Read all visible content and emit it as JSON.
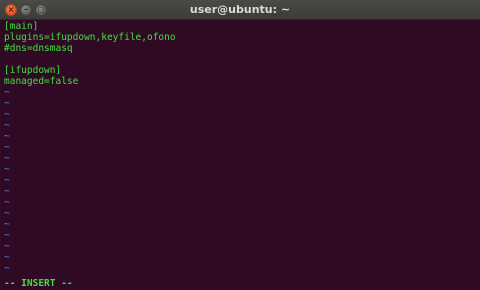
{
  "window": {
    "title": "user@ubuntu: ~",
    "close_glyph": "×",
    "minimize_glyph": "–",
    "maximize_glyph": "□"
  },
  "editor": {
    "lines": [
      "[main]",
      "plugins=ifupdown,keyfile,ofono",
      "#dns=dnsmasq",
      "",
      "[ifupdown]",
      "managed=false"
    ],
    "empty_line_marker": "~",
    "mode": "-- INSERT --"
  },
  "colors": {
    "terminal_bg": "#300a24",
    "text": "#3fe03c",
    "tilde": "#4a8be0",
    "titlebar": "#3c3b37",
    "close_button": "#e2511d"
  }
}
